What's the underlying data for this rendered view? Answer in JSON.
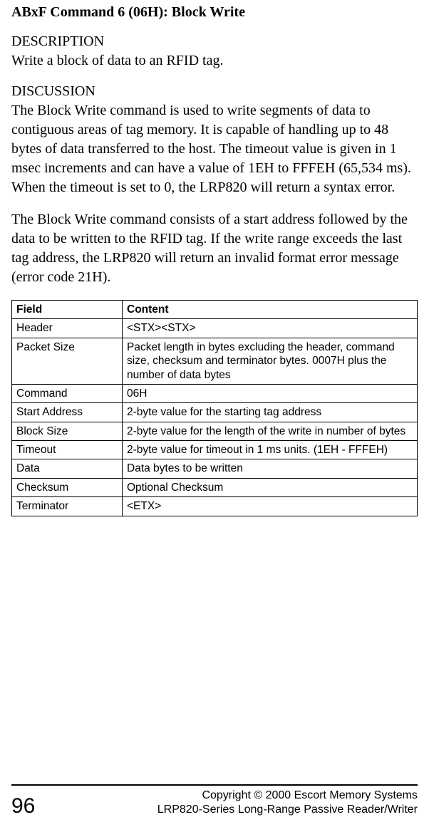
{
  "title": "ABxF Command 6 (06H): Block Write",
  "description": {
    "heading": "DESCRIPTION",
    "text": "Write a block of data to an RFID tag."
  },
  "discussion": {
    "heading": "DISCUSSION",
    "para1": "The Block Write command is used to write segments of data to contiguous areas of tag memory.  It is capable of handling up to 48 bytes of data transferred to the host. The timeout value is given in 1 msec increments and can have a value of 1EH to FFFEH (65,534 ms).  When the timeout is set to 0, the LRP820 will return a syntax error.",
    "para2": "The Block Write command consists of a start address followed by the data to be written to the RFID tag.  If the write range exceeds the last tag address, the LRP820 will return an invalid format error message (error code 21H)."
  },
  "table": {
    "headers": {
      "field": "Field",
      "content": "Content"
    },
    "rows": [
      {
        "field": "Header",
        "content": "<STX><STX>"
      },
      {
        "field": "Packet Size",
        "content": "Packet length in bytes excluding the header, command size, checksum and terminator bytes.  0007H plus the number of data bytes"
      },
      {
        "field": "Command",
        "content": "06H"
      },
      {
        "field": "Start Address",
        "content": "2-byte value for the starting tag address"
      },
      {
        "field": "Block Size",
        "content": "2-byte value for the length of the write in number of bytes"
      },
      {
        "field": "Timeout",
        "content": "2-byte value for timeout in 1 ms units. (1EH - FFFEH)"
      },
      {
        "field": "Data",
        "content": "Data bytes to be written"
      },
      {
        "field": "Checksum",
        "content": "Optional Checksum"
      },
      {
        "field": "Terminator",
        "content": "<ETX>"
      }
    ]
  },
  "footer": {
    "pageNumber": "96",
    "line1": "Copyright © 2000 Escort Memory Systems",
    "line2": "LRP820-Series Long-Range Passive Reader/Writer"
  }
}
